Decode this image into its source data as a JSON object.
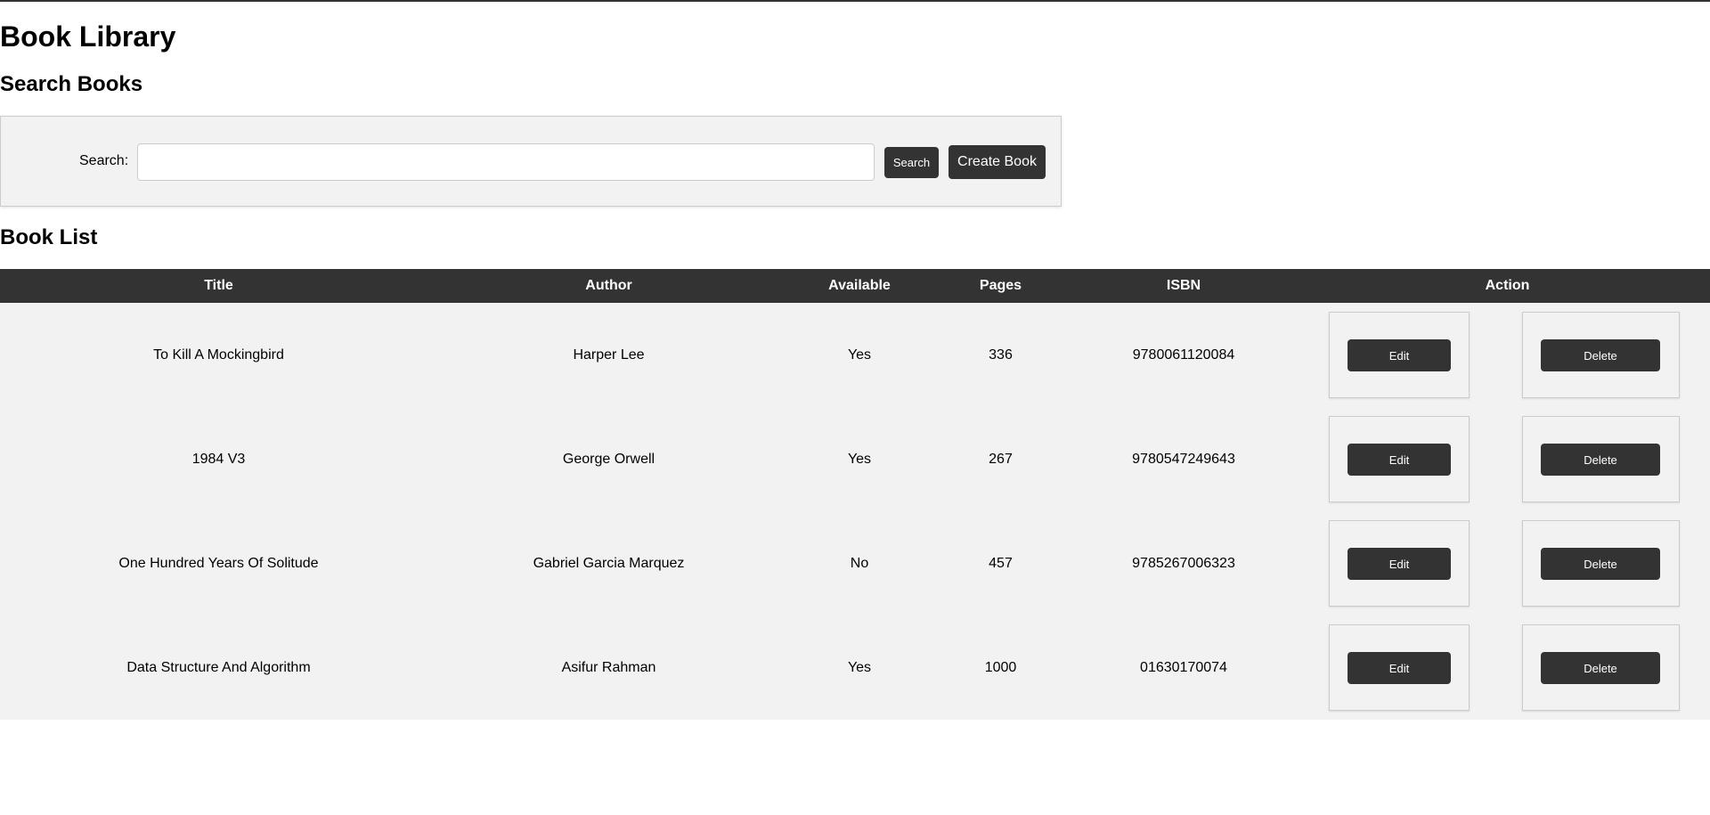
{
  "page": {
    "title": "Book Library"
  },
  "search": {
    "heading": "Search Books",
    "label": "Search:",
    "value": "",
    "placeholder": "",
    "search_button": "Search",
    "create_button": "Create Book"
  },
  "book_list": {
    "heading": "Book List",
    "columns": {
      "title": "Title",
      "author": "Author",
      "available": "Available",
      "pages": "Pages",
      "isbn": "ISBN",
      "action": "Action"
    },
    "edit_label": "Edit",
    "delete_label": "Delete",
    "rows": [
      {
        "title": "To Kill A Mockingbird",
        "author": "Harper Lee",
        "available": "Yes",
        "pages": "336",
        "isbn": "9780061120084"
      },
      {
        "title": "1984 V3",
        "author": "George Orwell",
        "available": "Yes",
        "pages": "267",
        "isbn": "9780547249643"
      },
      {
        "title": "One Hundred Years Of Solitude",
        "author": "Gabriel Garcia Marquez",
        "available": "No",
        "pages": "457",
        "isbn": "9785267006323"
      },
      {
        "title": "Data Structure And Algorithm",
        "author": "Asifur Rahman",
        "available": "Yes",
        "pages": "1000",
        "isbn": "01630170074"
      }
    ]
  },
  "colors": {
    "header_bg": "#333333",
    "row_bg": "#f2f2f2",
    "button_bg": "#333333"
  }
}
